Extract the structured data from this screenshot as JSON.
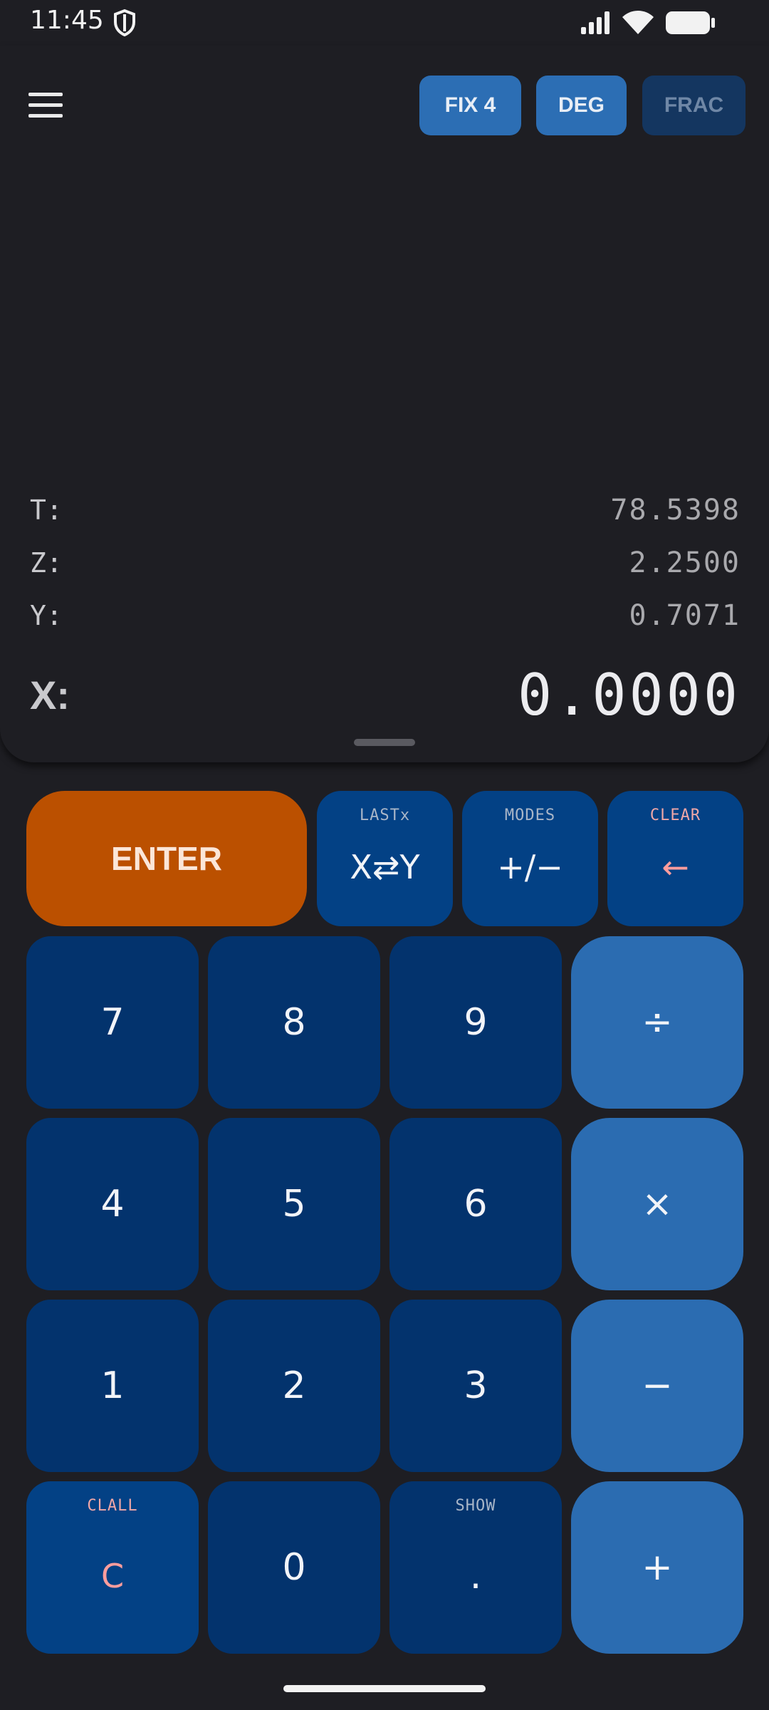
{
  "status": {
    "time": "11:45",
    "icons": [
      "shield-icon",
      "signal-icon",
      "wifi-icon",
      "battery-icon"
    ]
  },
  "header": {
    "menu_icon": "hamburger-menu-icon",
    "modes": [
      {
        "label": "FIX 4",
        "active": true
      },
      {
        "label": "DEG",
        "active": true
      },
      {
        "label": "FRAC",
        "active": false
      }
    ]
  },
  "stack": {
    "t": {
      "label": "T:",
      "value": "78.5398"
    },
    "z": {
      "label": "Z:",
      "value": "2.2500"
    },
    "y": {
      "label": "Y:",
      "value": "0.7071"
    },
    "x": {
      "label": "X:",
      "value": "0.0000"
    }
  },
  "keys": {
    "enter": "ENTER",
    "swap": {
      "main": "X⇄Y",
      "sub": "LASTx"
    },
    "sign": {
      "main": "+/−",
      "sub": "MODES"
    },
    "back": {
      "main": "←",
      "sub": "CLEAR"
    },
    "digits": [
      "7",
      "8",
      "9",
      "4",
      "5",
      "6",
      "1",
      "2",
      "3",
      "0"
    ],
    "clear": {
      "main": "C",
      "sub": "CLALL"
    },
    "dot": {
      "main": ".",
      "sub": "SHOW"
    },
    "ops": {
      "divide": "÷",
      "multiply": "×",
      "minus": "−",
      "plus": "+"
    }
  },
  "colors": {
    "background": "#1e1e23",
    "enter": "#bb5000",
    "digit_key": "#03336d",
    "function_key": "#034185",
    "operator_key": "#2b6cb1",
    "accent_pink": "#ff9d9d"
  }
}
